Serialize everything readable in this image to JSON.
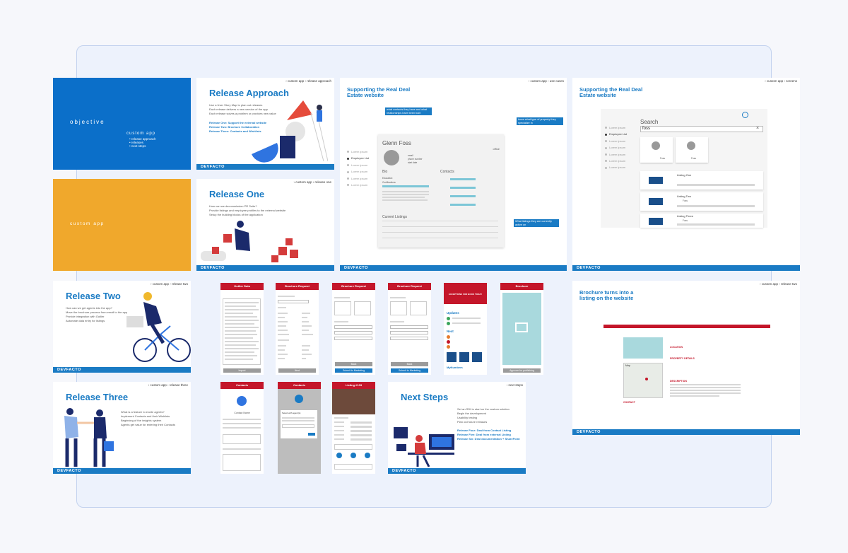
{
  "brand": "DEVFACTO",
  "colors": {
    "primary_blue": "#1a7bc4",
    "objective_blue": "#0b6fc9",
    "custom_orange": "#f0a82c",
    "brochure_red": "#c4162a",
    "board_border": "#c3d2ee"
  },
  "objective": {
    "title": "objective",
    "subtitle": "custom app",
    "items": [
      "• release approach",
      "• releases",
      "• next steps"
    ]
  },
  "custom_app": {
    "title": "custom app"
  },
  "release_approach": {
    "crumb": "› custom app › release approach",
    "title": "Release Approach",
    "lines": [
      "Use a User Story Map to plan out releases",
      "Each release delivers a new version of the app",
      "Each release solves a problem or provides new value"
    ],
    "releases": [
      "Release One: Support the external website",
      "Release Two: Brochure Collaboration",
      "Release Three: Contacts and Wishlists"
    ]
  },
  "release_one": {
    "crumb": "› custom app › release one",
    "title": "Release One",
    "lines": [
      "How can we decommission PR Suite?",
      "Provide listings and employee profiles to the external website",
      "Setup the building blocks of the application"
    ]
  },
  "use_cases": {
    "crumb": "› custom app › use cases",
    "title_lines": [
      "Supporting the Real Deal",
      "Estate website"
    ],
    "callout_1": "what contacts they have and what relationships have been built",
    "callout_2": "know what type of property they specialize in",
    "callout_3": "What listings they are currently active on",
    "nav": [
      "Lorem ipsum",
      "Employee List",
      "Lorem ipsum",
      "Lorem ipsum",
      "Lorem ipsum",
      "Lorem ipsum"
    ],
    "profile_name": "Glenn Foss",
    "office": "office",
    "fields": [
      "email",
      "phone number",
      "start date"
    ],
    "bio": "Bio",
    "education": "Education:",
    "certifications": "Certifications:",
    "contacts": "Contacts",
    "current_listings": "Current Listings"
  },
  "screens": {
    "crumb": "› custom app › screens",
    "title_lines": [
      "Supporting the Real Deal",
      "Estate website"
    ],
    "search_label": "Search",
    "search_value": "foss",
    "nav": [
      "Lorem ipsum",
      "Employee List",
      "Lorem ipsum",
      "Lorem ipsum",
      "Lorem ipsum",
      "Lorem ipsum",
      "Lorem ipsum"
    ],
    "people": [
      "Foss",
      "Foss"
    ],
    "listings": [
      "Listing One",
      "Listing Two",
      "Listing Three"
    ],
    "listing_tags": [
      "Foss",
      "Foss",
      "Foss"
    ]
  },
  "release_two": {
    "crumb": "› custom app › release two",
    "title": "Release Two",
    "lines": [
      "How can we get agents into the app?",
      "Move the brochure process from email to the app",
      "Provide integration with Outlier",
      "Automate data entry for listings"
    ]
  },
  "release_three": {
    "crumb": "› custom app › release three",
    "title": "Release Three",
    "lines": [
      "What is a feature to excite agents?",
      "Implement Contacts and their Wishlists",
      "Beginning of the insights system",
      "Agents get value for entering their Contacts"
    ]
  },
  "phones_row1": [
    {
      "header": "Outlier Data",
      "button": "Import"
    },
    {
      "header": "Brochure Request",
      "button": "Next"
    },
    {
      "header": "Brochure Request",
      "button": "Submit to Marketing",
      "sub_button": "Back"
    },
    {
      "header": "Brochure Request",
      "button": "Submit to Marketing",
      "sub_button": "Back"
    },
    {
      "header": "EXCEPTIONS FOR BOOK TODAY",
      "sections": [
        "Updates",
        "Next",
        "MyNumbers"
      ]
    },
    {
      "header": "Brochure",
      "button": "Approve for publishing"
    }
  ],
  "phones_row2": [
    {
      "header": "Contacts",
      "name": "Contact Name"
    },
    {
      "header": "Contacts",
      "dialog": "Select with agent(s)"
    },
    {
      "header": "Listing #133"
    }
  ],
  "next_steps": {
    "crumb": "› next steps",
    "title": "Next Steps",
    "lines": [
      "Set an SDI to start on the custom solution",
      "Begin the development",
      "Usability testing",
      "Plan out future releases"
    ],
    "releases": [
      "Release Four: Deal from Contact Listing",
      "Release Five: Deal from external Listing",
      "Release Six: Deal documentation + SharePoint"
    ]
  },
  "brochure_web": {
    "crumb": "› custom app › release two",
    "title_lines": [
      "Brochure turns into a",
      "listing on the website"
    ],
    "sections": [
      "LOCATION",
      "PROPERTY DETAILS",
      "DESCRIPTION",
      "CONTACT"
    ],
    "map_label": "Map"
  }
}
